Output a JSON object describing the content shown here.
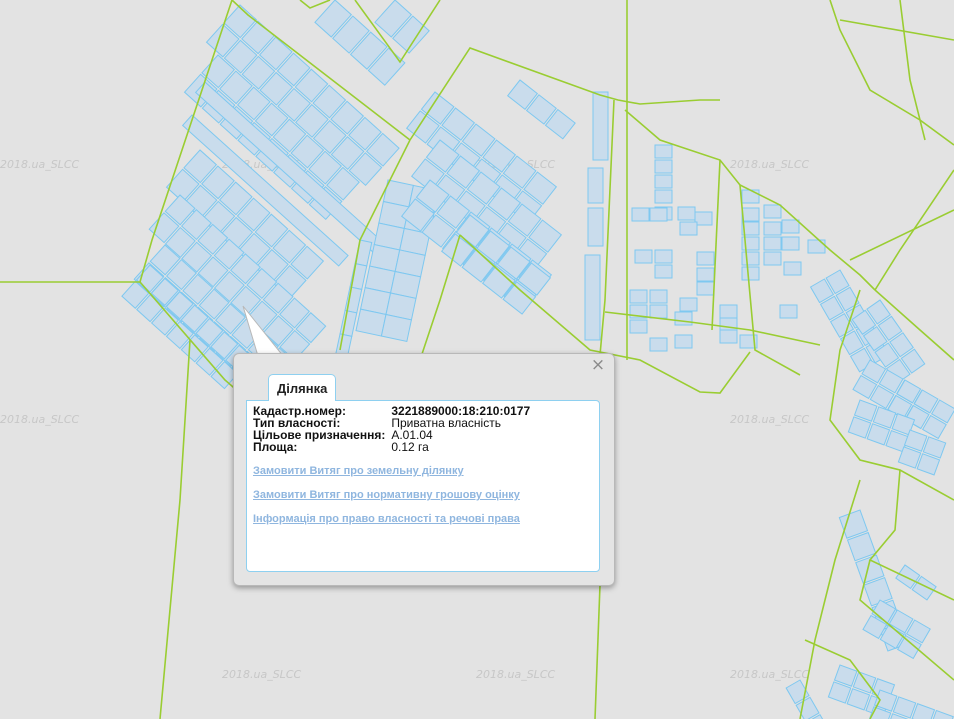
{
  "watermark": "2018.ua_SLCC",
  "colors": {
    "background": "#e3e3e3",
    "boundary_line": "#9acd32",
    "parcel_stroke": "#7ec8f0",
    "parcel_fill": "#c9dcec",
    "link": "#8fb6df"
  },
  "popup": {
    "tab_label": "Ділянка",
    "close_label": "×",
    "attributes": [
      {
        "key": "Кадастр.номер:",
        "value": "3221889000:18:210:0177"
      },
      {
        "key": "Тип власності:",
        "value": "Приватна власність"
      },
      {
        "key": "Цільове призначення:",
        "value": "A.01.04"
      },
      {
        "key": "Площа:",
        "value": "0.12 га"
      }
    ],
    "links": [
      {
        "label": "Замовити Витяг про земельну ділянку"
      },
      {
        "label": "Замовити Витяг про нормативну грошову оцінку"
      },
      {
        "label": "Інформація про право власності та речові права"
      }
    ]
  }
}
